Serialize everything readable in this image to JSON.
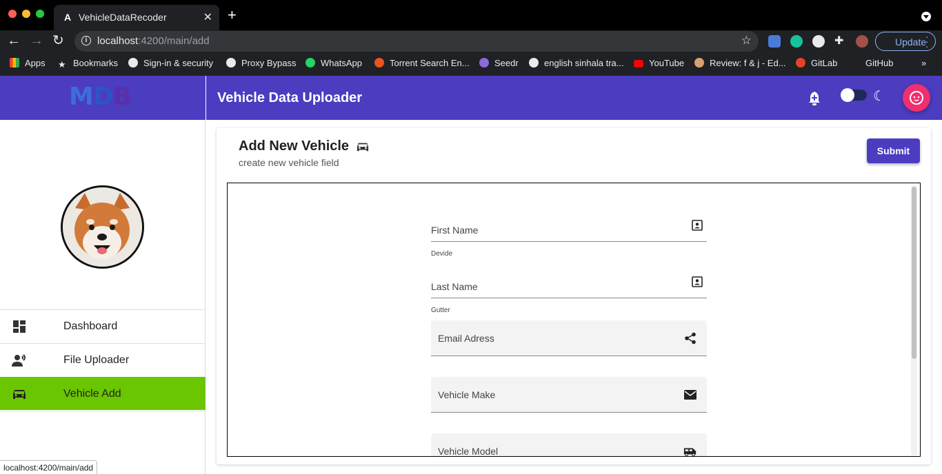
{
  "browser": {
    "tab_title": "VehicleDataRecoder",
    "url_host": "localhost",
    "url_path": ":4200/main/add",
    "update_label": "Update",
    "status_url": "localhost:4200/main/add"
  },
  "bookmarks": [
    {
      "label": "Apps",
      "icon": "apps-grid-icon",
      "color": "#e8eaed"
    },
    {
      "label": "Bookmarks",
      "icon": "star-icon",
      "color": "#e8eaed"
    },
    {
      "label": "Sign-in & security",
      "icon": "google-icon",
      "color": "#e8eaed"
    },
    {
      "label": "Proxy Bypass",
      "icon": "proxy-icon",
      "color": "#e8eaed"
    },
    {
      "label": "WhatsApp",
      "icon": "whatsapp-icon",
      "color": "#25d366"
    },
    {
      "label": "Torrent Search En...",
      "icon": "torrent-icon",
      "color": "#e8541c"
    },
    {
      "label": "Seedr",
      "icon": "seedr-icon",
      "color": "#8a6ad8"
    },
    {
      "label": "english sinhala tra...",
      "icon": "google-icon",
      "color": "#e8eaed"
    },
    {
      "label": "YouTube",
      "icon": "youtube-icon",
      "color": "#ff0000"
    },
    {
      "label": "Review: f & j - Ed...",
      "icon": "review-icon",
      "color": "#d8a070"
    },
    {
      "label": "GitLab",
      "icon": "gitlab-icon",
      "color": "#e24329"
    },
    {
      "label": "GitHub",
      "icon": "github-icon",
      "color": "#222222"
    }
  ],
  "app": {
    "logo": "MDB",
    "header_title": "Vehicle Data Uploader",
    "brand_color": "#4b3cc0",
    "active_color": "#6ac600",
    "user_fab_color": "#ef2f6e"
  },
  "sidebar": {
    "items": [
      {
        "label": "Dashboard",
        "icon": "dashboard-icon"
      },
      {
        "label": "File Uploader",
        "icon": "record-voice-icon"
      },
      {
        "label": "Vehicle Add",
        "icon": "car-icon",
        "active": true
      }
    ]
  },
  "card": {
    "title": "Add New Vehicle",
    "subtitle": "create new vehicle field",
    "submit_label": "Submit"
  },
  "form": {
    "first_name": {
      "label": "First Name",
      "hint": "Devide",
      "icon": "contact-icon"
    },
    "last_name": {
      "label": "Last Name",
      "hint": "Gutter",
      "icon": "contact-icon"
    },
    "email": {
      "label": "Email Adress",
      "icon": "share-icon"
    },
    "vehicle_make": {
      "label": "Vehicle Make",
      "icon": "mail-icon"
    },
    "vehicle_model": {
      "label": "Vehicle Model",
      "icon": "van-icon"
    }
  }
}
